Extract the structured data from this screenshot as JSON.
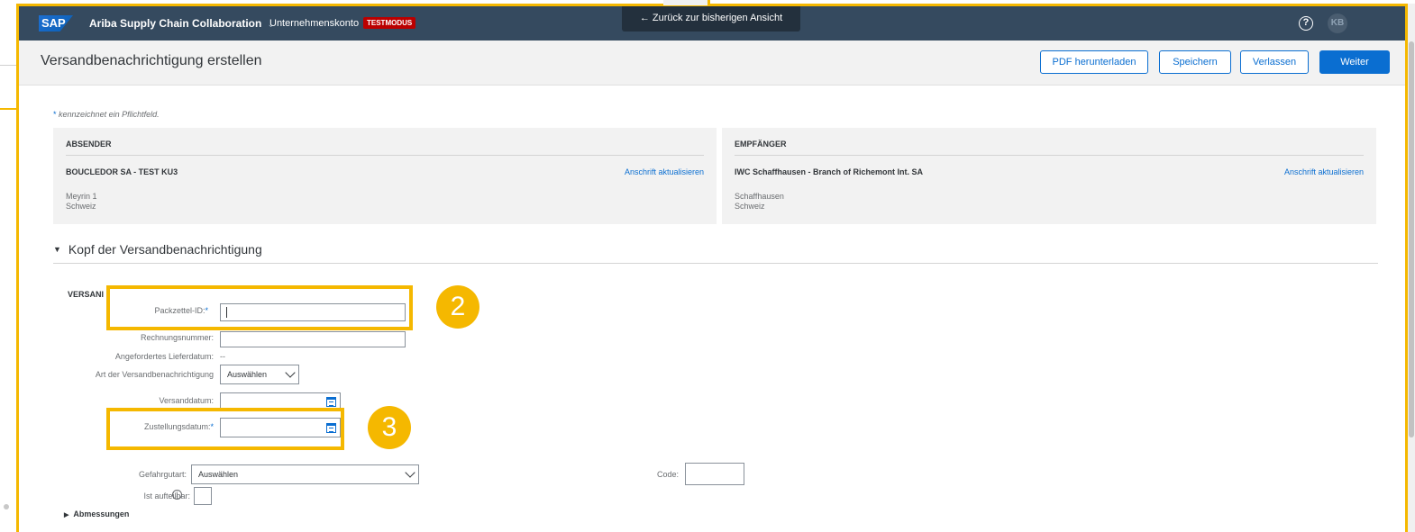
{
  "topbar": {
    "logo": "SAP",
    "app_title": "Ariba Supply Chain Collaboration",
    "app_title_chevron": "⌄",
    "account_label": "Unternehmenskonto",
    "test_badge": "TESTMODUS",
    "back_link": "← Zurück zur bisherigen Ansicht",
    "help": "?",
    "avatar_initials": "KB"
  },
  "header": {
    "title": "Versandbenachrichtigung erstellen",
    "buttons": {
      "pdf": "PDF herunterladen",
      "save": "Speichern",
      "exit": "Verlassen",
      "next": "Weiter"
    }
  },
  "required_note": {
    "star": "*",
    "text": "kennzeichnet ein Pflichtfeld."
  },
  "sender": {
    "heading": "ABSENDER",
    "name": "BOUCLEDOR SA - TEST KU3",
    "update_link": "Anschrift aktualisieren",
    "city": "Meyrin 1",
    "country": "Schweiz"
  },
  "recipient": {
    "heading": "EMPFÄNGER",
    "name": "IWC Schaffhausen - Branch of Richemont Int. SA",
    "update_link": "Anschrift aktualisieren",
    "city": "Schaffhausen",
    "country": "Schweiz"
  },
  "section": {
    "arrow": "▼",
    "title": "Kopf der Versandbenachrichtigung",
    "sub_label": "VERSANI"
  },
  "form": {
    "packing_slip_label": "Packzettel-ID:",
    "invoice_label": "Rechnungsnummer:",
    "requested_delivery_label": "Angefordertes Lieferdatum:",
    "requested_delivery_value": "--",
    "notice_type_label": "Art der Versandbenachrichtigung",
    "notice_type_value": "Auswählen",
    "ship_date_label": "Versanddatum:",
    "delivery_date_label": "Zustellungsdatum:",
    "hazard_label": "Gefahrgutart:",
    "hazard_value": "Auswählen",
    "code_label": "Code:",
    "divisible_label": "Ist aufteilbar:",
    "info": "i",
    "dimensions_arrow": "▶",
    "dimensions": "Abmessungen",
    "required_star": "*"
  },
  "annotations": {
    "badge_2": "2",
    "badge_3": "3",
    "highlight_color": "#f5b800"
  },
  "colors": {
    "shell": "#354a5f",
    "accent": "#0a6ed1",
    "test_badge": "#bb0000"
  }
}
